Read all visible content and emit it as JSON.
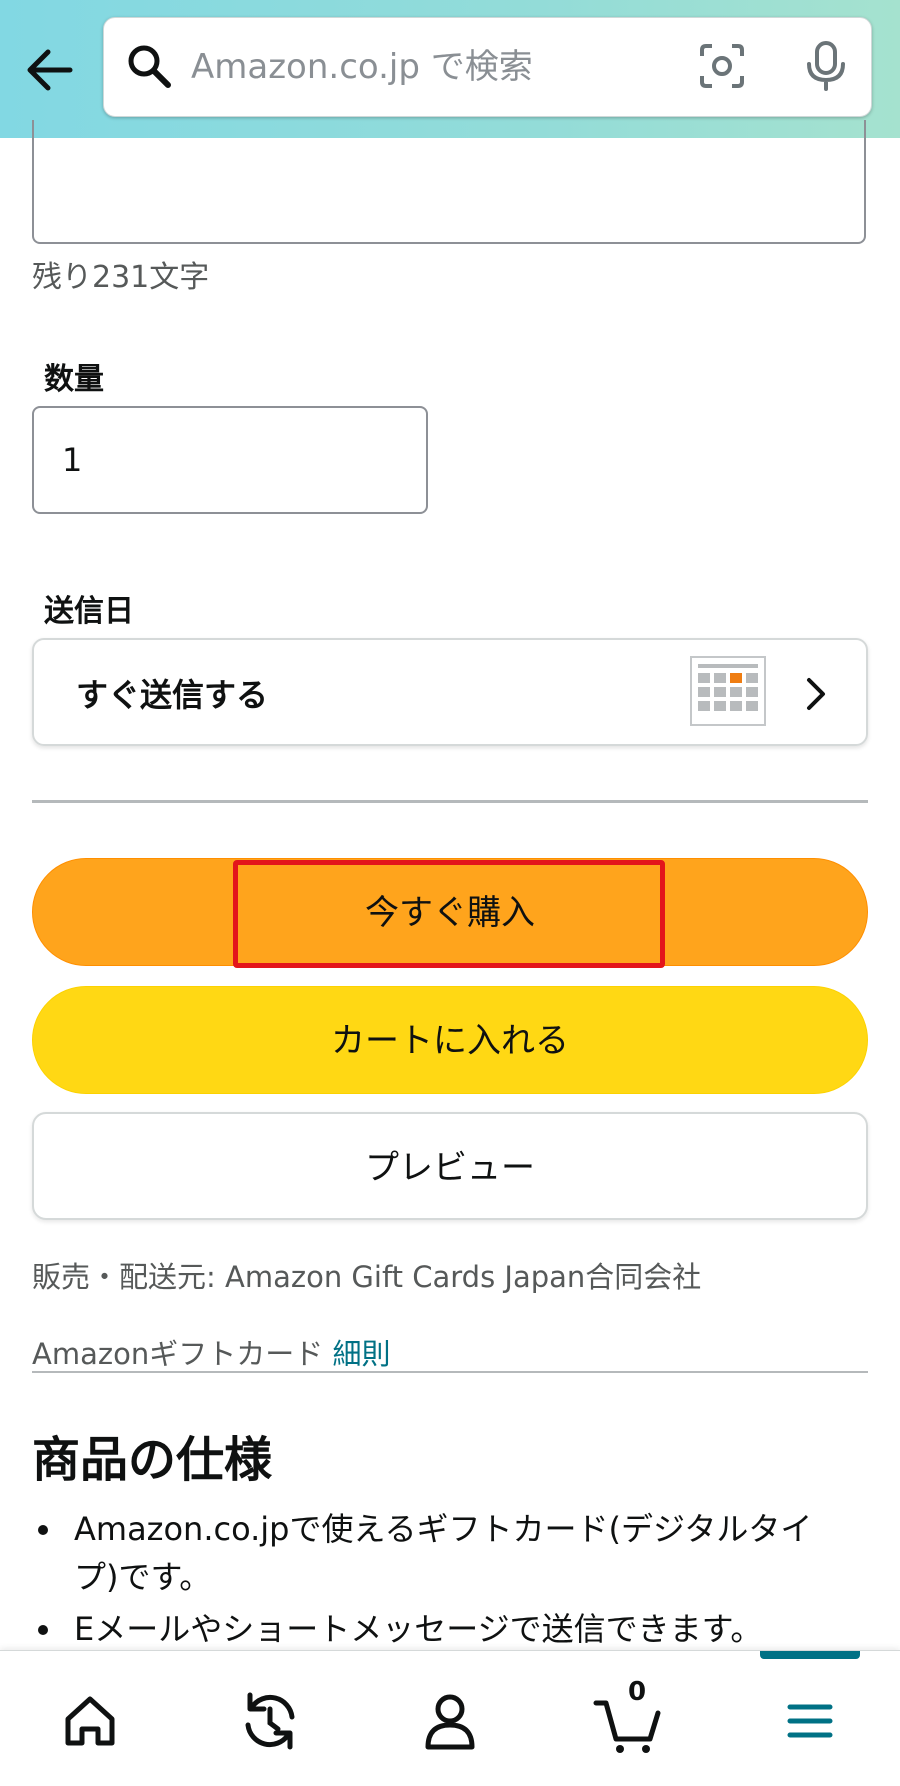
{
  "header": {
    "search_placeholder": "Amazon.co.jp で検索"
  },
  "form": {
    "remaining_chars": "残り231文字",
    "quantity_label": "数量",
    "quantity_value": "1",
    "send_date_label": "送信日",
    "send_date_value": "すぐ送信する"
  },
  "buttons": {
    "buy_now": "今すぐ購入",
    "add_to_cart": "カートに入れる",
    "preview": "プレビュー"
  },
  "info": {
    "seller": "販売・配送元: Amazon Gift Cards Japan合同会社",
    "gift_card_label": "Amazonギフトカード",
    "terms_link": "細則"
  },
  "specs": {
    "title": "商品の仕様",
    "items": [
      "Amazon.co.jpで使えるギフトカード(デジタルタイプ)です。",
      "Eメールやショートメッセージで送信できます。"
    ]
  },
  "bottom_nav": {
    "cart_count": "0"
  },
  "colors": {
    "buy_now": "#ffa41c",
    "add_to_cart": "#ffd814",
    "link": "#007185",
    "highlight": "#e3151b"
  }
}
